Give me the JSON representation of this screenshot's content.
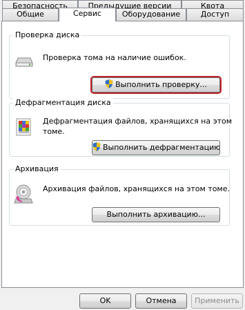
{
  "tabs_top": [
    "Безопасность",
    "Предыдущие версии",
    "Квота"
  ],
  "tabs_bottom": [
    "Общие",
    "Сервис",
    "Оборудование",
    "Доступ"
  ],
  "active_tab": "Сервис",
  "check": {
    "title": "Проверка диска",
    "text": "Проверка тома на наличие ошибок.",
    "button": "Выполнить проверку..."
  },
  "defrag": {
    "title": "Дефрагментация диска",
    "text_line1": "Дефрагментация файлов, хранящихся на этом",
    "text_line2": "томе.",
    "button": "Выполнить дефрагментацию..."
  },
  "backup": {
    "title": "Архивация",
    "text": "Архивация файлов, хранящихся на этом томе.",
    "button": "Выполнить архивацию..."
  },
  "footer": {
    "ok": "OK",
    "cancel": "Отмена",
    "apply": "Применить"
  }
}
